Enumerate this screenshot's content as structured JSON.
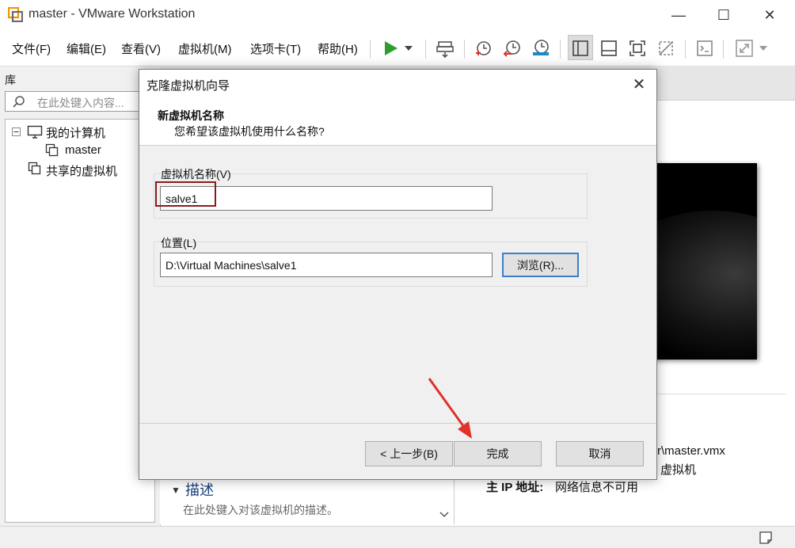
{
  "window": {
    "title": "master - VMware Workstation",
    "minimize": "—",
    "maximize": "☐",
    "close": "✕"
  },
  "menu": {
    "items": [
      "文件(F)",
      "编辑(E)",
      "查看(V)",
      "虚拟机(M)",
      "选项卡(T)",
      "帮助(H)"
    ]
  },
  "toolbar": {
    "icons": [
      "play-icon",
      "dropdown-caret-icon",
      "send-keys-icon",
      "snapshot-take-icon",
      "snapshot-revert-icon",
      "snapshot-manager-icon",
      "sidebar-view-icon",
      "thumbnail-view-icon",
      "fullscreen-icon",
      "unity-icon",
      "console-icon",
      "stretch-icon"
    ]
  },
  "library": {
    "header": "库",
    "search_placeholder": "在此处键入内容...",
    "tree": {
      "my_computer": "我的计算机",
      "vm_master": "master",
      "shared_vms": "共享的虚拟机"
    }
  },
  "details": {
    "vmx_fragment": "r\\master.vmx",
    "vm_fragment": "虚拟机",
    "ip_label": "主 IP 地址:",
    "ip_value": "网络信息不可用",
    "desc_title": "描述",
    "desc_hint": "在此处键入对该虚拟机的描述。"
  },
  "dialog": {
    "title": "克隆虚拟机向导",
    "heading": "新虚拟机名称",
    "subheading": "您希望该虚拟机使用什么名称?",
    "name_label": "虚拟机名称(V)",
    "name_value": "salve1",
    "location_label": "位置(L)",
    "location_value": "D:\\Virtual Machines\\salve1",
    "browse_button": "浏览(R)...",
    "back_button": "< 上一步(B)",
    "finish_button": "完成",
    "cancel_button": "取消",
    "close": "✕"
  },
  "colors": {
    "accent_blue": "#3d7fc9",
    "highlight_red": "#8b1a1a",
    "play_green": "#2e9e2e",
    "annotation_red": "#e0312b"
  }
}
